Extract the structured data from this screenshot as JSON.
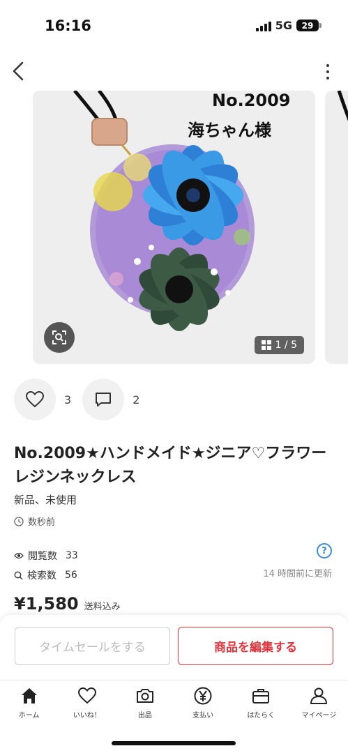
{
  "status": {
    "time": "16:16",
    "network": "5G",
    "battery": "29"
  },
  "gallery": {
    "overlay_number": "No.2009",
    "overlay_name": "海ちゃん様",
    "counter": "1 / 5"
  },
  "actions": {
    "likes": "3",
    "comments": "2"
  },
  "item": {
    "title": "No.2009★ハンドメイド★ジニア♡フラワーレジンネックレス",
    "condition": "新品、未使用",
    "posted": "数秒前"
  },
  "stats": {
    "views_label": "閲覧数",
    "views": "33",
    "searches_label": "検索数",
    "searches": "56",
    "updated": "14 時間前に更新",
    "help": "?"
  },
  "price": {
    "value": "¥1,580",
    "note": "送料込み"
  },
  "buttons": {
    "timesale": "タイムセールをする",
    "edit": "商品を編集する"
  },
  "tabs": [
    {
      "label": "ホーム",
      "icon": "home-icon"
    },
    {
      "label": "いいね！",
      "icon": "heart-icon"
    },
    {
      "label": "出品",
      "icon": "camera-icon"
    },
    {
      "label": "支払い",
      "icon": "yen-icon"
    },
    {
      "label": "はたらく",
      "icon": "briefcase-icon"
    },
    {
      "label": "マイページ",
      "icon": "person-icon"
    }
  ],
  "colors": {
    "accent": "#e4333a",
    "link": "#3b8ed8"
  }
}
